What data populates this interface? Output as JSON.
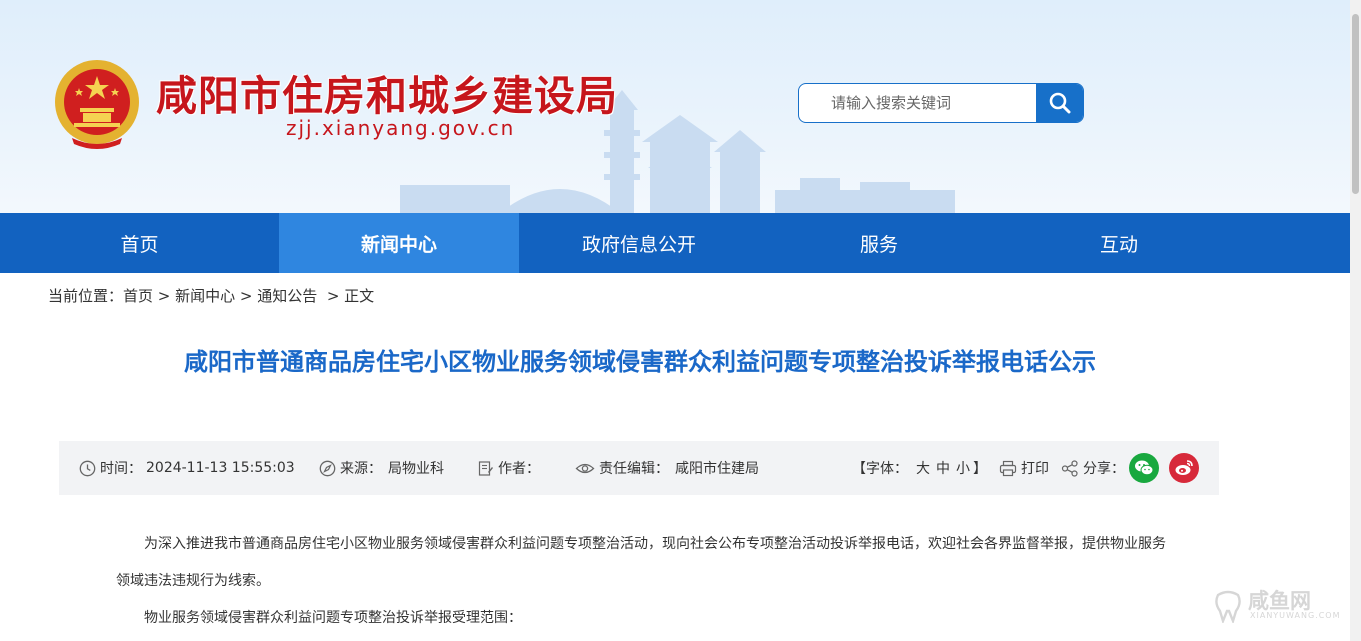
{
  "header": {
    "site_title": "咸阳市住房和城乡建设局",
    "site_domain": "zjj.xianyang.gov.cn",
    "search_placeholder": "请输入搜索关键词"
  },
  "nav": {
    "items": [
      {
        "label": "首页"
      },
      {
        "label": "新闻中心"
      },
      {
        "label": "政府信息公开"
      },
      {
        "label": "服务"
      },
      {
        "label": "互动"
      }
    ]
  },
  "breadcrumb": {
    "prefix": "当前位置：",
    "home": "首页",
    "sep1": " > ",
    "news": "新闻中心",
    "sep2": " > ",
    "notices": "通知公告",
    "sep3": "  > ",
    "current": "正文"
  },
  "article": {
    "title": "咸阳市普通商品房住宅小区物业服务领域侵害群众利益问题专项整治投诉举报电话公示",
    "meta": {
      "time_label": "时间：",
      "time_value": "2024-11-13 15:55:03",
      "source_label": "来源：",
      "source_value": "局物业科",
      "author_label": "作者：",
      "editor_label": "责任编辑：",
      "editor_value": "咸阳市住建局",
      "font_open": "【字体：",
      "font_large": "大",
      "font_medium": "中",
      "font_small": "小",
      "font_close": "】",
      "print": "打印",
      "share": "分享："
    },
    "paragraphs": [
      "为深入推进我市普通商品房住宅小区物业服务领域侵害群众利益问题专项整治活动，现向社会公布专项整治活动投诉举报电话，欢迎社会各界监督举报，提供物业服务领域违法违规行为线索。",
      "物业服务领域侵害群众利益问题专项整治投诉举报受理范围："
    ]
  },
  "watermark": {
    "text": "咸鱼网",
    "sub": "XIANYUWANG.COM"
  },
  "colors": {
    "nav_bg": "#1262c0",
    "nav_active": "#2f86e0",
    "title_blue": "#1a68c8",
    "brand_red": "#c6161c",
    "wechat_green": "#19a83f",
    "weibo_red": "#d7293a"
  },
  "icons": {
    "search": "search-icon",
    "time": "clock-icon",
    "source": "compass-icon",
    "author": "pen-icon",
    "editor": "eye-icon",
    "print": "printer-icon",
    "share": "share-icon",
    "wechat": "wechat-icon",
    "weibo": "weibo-icon"
  }
}
